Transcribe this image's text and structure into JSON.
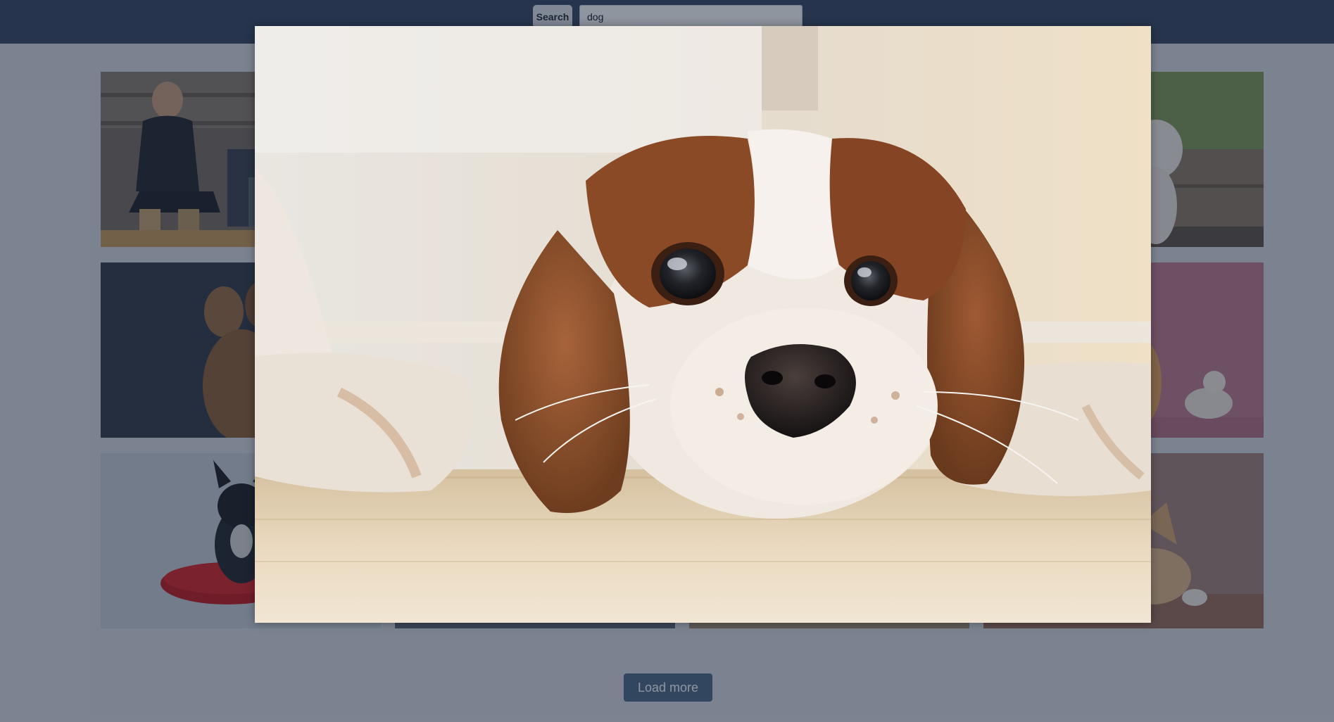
{
  "header": {
    "search_button_label": "Search",
    "search_input_value": "dog"
  },
  "gallery": {
    "load_more_label": "Load more"
  },
  "colors": {
    "header_background": "#364763",
    "button_dark": "#4e6a85",
    "overlay_tint": "#142236"
  }
}
